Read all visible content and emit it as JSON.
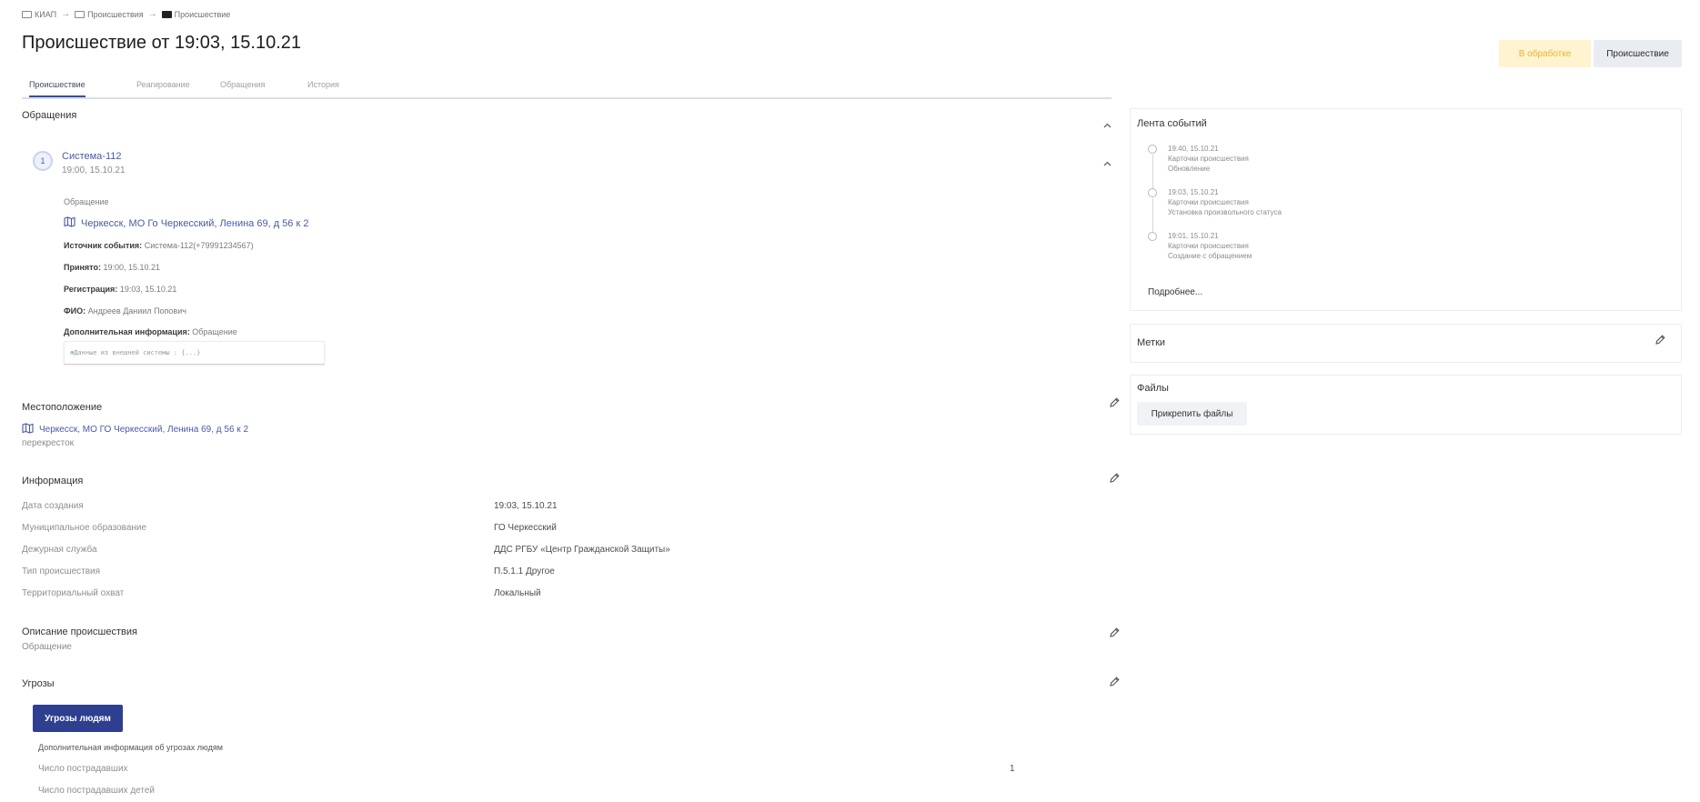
{
  "breadcrumb": [
    "КИАП",
    "Происшествия",
    "Происшествие"
  ],
  "title": "Происшествие от 19:03, 15.10.21",
  "status": "В обработке",
  "type_button": "Происшествие",
  "tabs": [
    "Происшествие",
    "Реагирование",
    "Обращения",
    "История"
  ],
  "appeals": {
    "title": "Обращения",
    "index": "1",
    "source_name": "Система-112",
    "source_time": "19:00, 15.10.21",
    "kind": "Обращение",
    "address": "Черкесск, МО Го Черкесский, Ленина 69, д 56 к 2",
    "fields": [
      {
        "label": "Источник события:",
        "value": "Система-112(+79991234567)"
      },
      {
        "label": "Принято:",
        "value": "19:00, 15.10.21"
      },
      {
        "label": "Регистрация:",
        "value": "19:03, 15.10.21"
      },
      {
        "label": "ФИО:",
        "value": "Андреев Даниил Попович"
      },
      {
        "label": "Дополнительная информация:",
        "value": "Обращение"
      }
    ],
    "external_data": "Данные из внешней системы : {...}"
  },
  "location": {
    "title": "Местоположение",
    "address": "Черкесск, МО ГО Черкесский, Ленина 69, д 56 к 2",
    "note": "перекресток"
  },
  "information": {
    "title": "Информация",
    "rows": [
      {
        "label": "Дата создания",
        "value": "19:03, 15.10.21"
      },
      {
        "label": "Муниципальное образование",
        "value": "ГО Черкесский"
      },
      {
        "label": "Дежурная служба",
        "value": "ДДС РГБУ «Центр Гражданской Защиты»"
      },
      {
        "label": "Тип происшествия",
        "value": "П.5.1.1 Другое"
      },
      {
        "label": "Территориальный охват",
        "value": "Локальный"
      }
    ]
  },
  "description": {
    "title": "Описание происшествия",
    "text": "Обращение"
  },
  "threats": {
    "title": "Угрозы",
    "button": "Угрозы людям",
    "subtitle": "Дополнительная информация об угрозах людям",
    "rows": [
      {
        "label": "Число пострадавших",
        "value": "1"
      },
      {
        "label": "Число пострадавших детей",
        "value": ""
      }
    ]
  },
  "event_feed": {
    "title": "Лента событий",
    "items": [
      {
        "time": "19:40, 15.10.21",
        "line1": "Карточки происшествия",
        "line2": "Обновление"
      },
      {
        "time": "19:03, 15.10.21",
        "line1": "Карточки происшествия",
        "line2": "Установка произвольного статуса"
      },
      {
        "time": "19:01, 15.10.21",
        "line1": "Карточки происшествия",
        "line2": "Создание с обращением"
      }
    ],
    "more": "Подробнее..."
  },
  "tags": {
    "title": "Метки"
  },
  "files": {
    "title": "Файлы",
    "attach": "Прикрепить файлы"
  },
  "colors": {
    "accent": "#2e3f8f",
    "link": "#4a5aa6",
    "status_bg": "#fff3d0",
    "status_fg": "#e9b52f"
  }
}
